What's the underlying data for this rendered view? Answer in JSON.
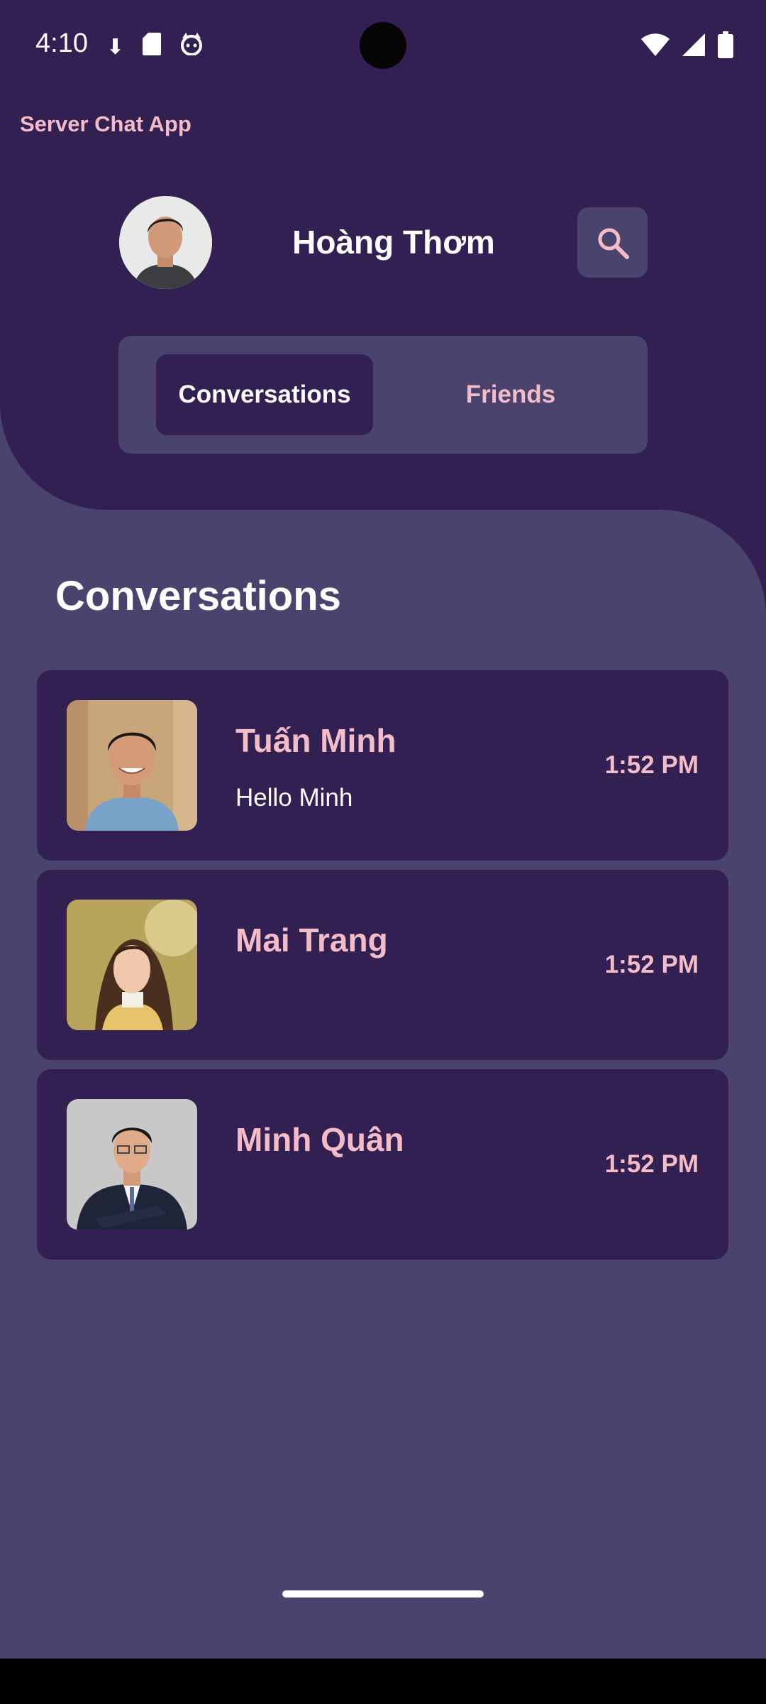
{
  "status_bar": {
    "time": "4:10",
    "left_icons": [
      "download-icon",
      "sd-card-icon",
      "cat-face-icon"
    ],
    "right_icons": [
      "wifi-icon",
      "cell-signal-icon",
      "battery-icon"
    ]
  },
  "app": {
    "title": "Server Chat App"
  },
  "profile": {
    "name": "Hoàng Thơm",
    "avatar": "profile-avatar"
  },
  "search": {
    "icon": "search-icon"
  },
  "tabs": [
    {
      "label": "Conversations",
      "active": true
    },
    {
      "label": "Friends",
      "active": false
    }
  ],
  "section": {
    "title": "Conversations"
  },
  "conversations": [
    {
      "name": "Tuấn Minh",
      "last_message": "Hello Minh",
      "time": "1:52 PM"
    },
    {
      "name": "Mai Trang",
      "last_message": "",
      "time": "1:52 PM"
    },
    {
      "name": "Minh Quân",
      "last_message": "",
      "time": "1:52 PM"
    }
  ],
  "colors": {
    "header_bg": "#332053",
    "body_bg": "#4a436e",
    "accent_pink": "#f3bcc6",
    "text_white": "#ffffff"
  }
}
